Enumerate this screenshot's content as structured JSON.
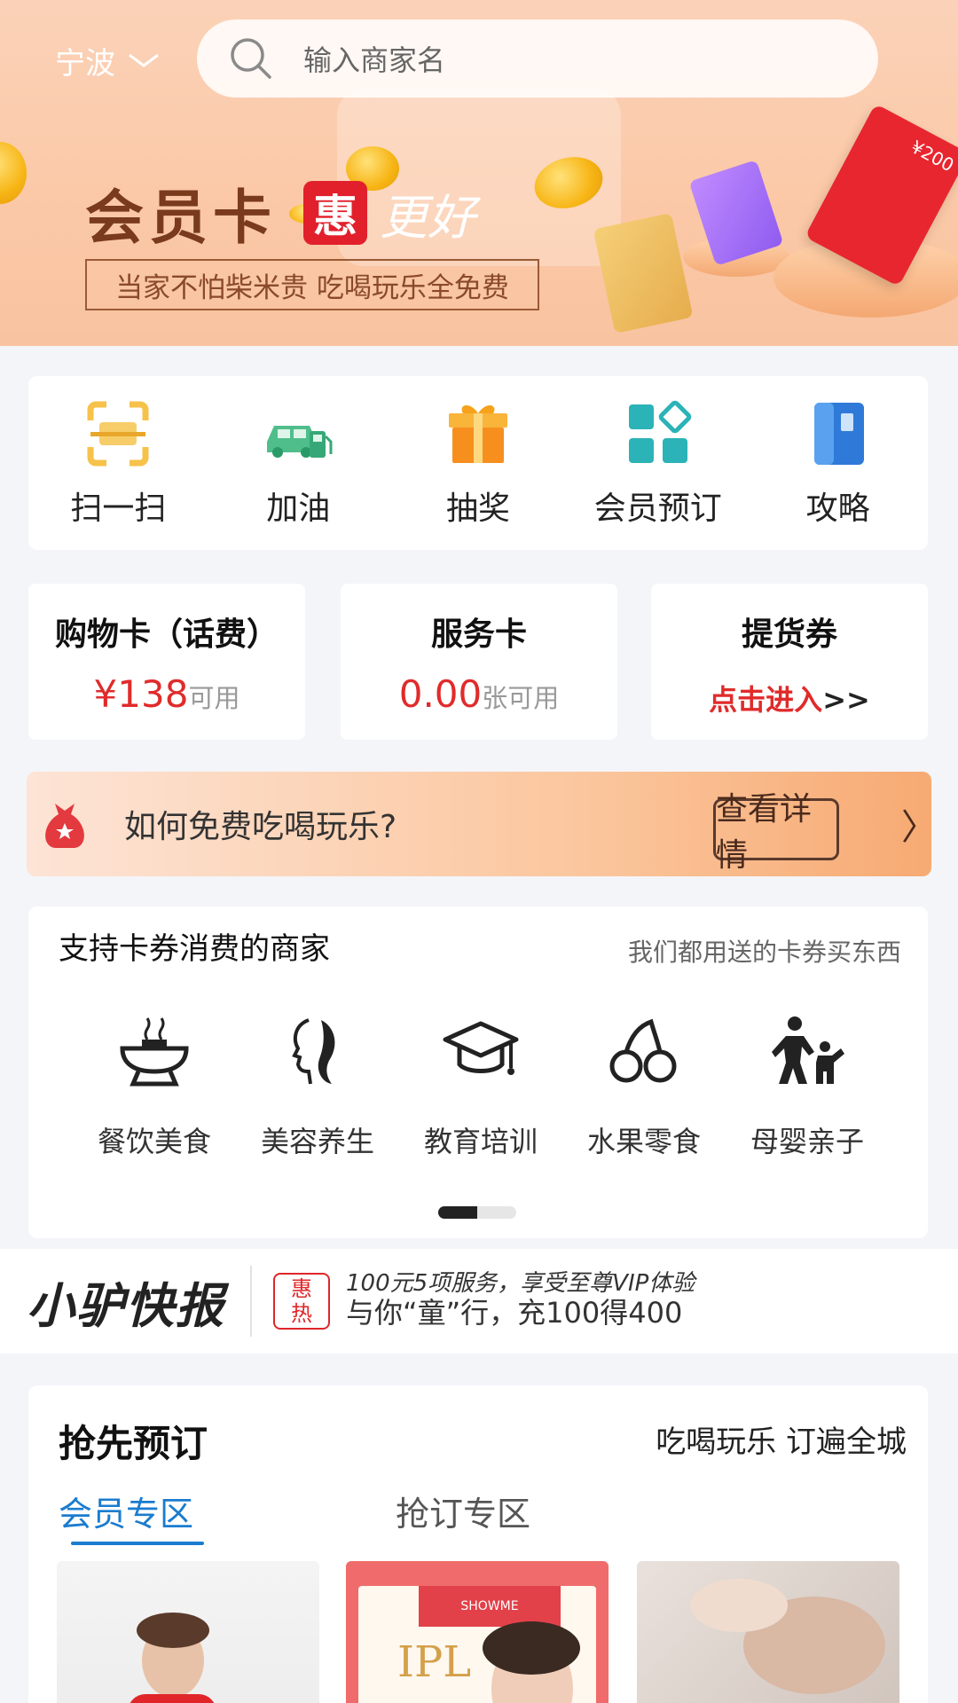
{
  "header": {
    "city": "宁波",
    "search_placeholder": "输入商家名"
  },
  "hero": {
    "title": "会员卡",
    "badge": "惠",
    "script": "更好",
    "subtitle": "当家不怕柴米贵 吃喝玩乐全免费",
    "card_red_text": "¥200"
  },
  "quick_actions": [
    {
      "label": "扫一扫",
      "icon": "scan-icon"
    },
    {
      "label": "加油",
      "icon": "fuel-icon"
    },
    {
      "label": "抽奖",
      "icon": "gift-icon"
    },
    {
      "label": "会员预订",
      "icon": "grid-icon"
    },
    {
      "label": "攻略",
      "icon": "guide-icon"
    }
  ],
  "cards": {
    "shopping": {
      "title": "购物卡（话费）",
      "value": "¥138",
      "unit": "可用"
    },
    "service": {
      "title": "服务卡",
      "value": "0.00",
      "unit": "张可用"
    },
    "voucher": {
      "title": "提货券",
      "link": "点击进入",
      "arrow": ">>"
    }
  },
  "promo": {
    "text": "如何免费吃喝玩乐?",
    "button": "查看详情",
    "chevron": "〉"
  },
  "merchants": {
    "title": "支持卡券消费的商家",
    "subtitle": "我们都用送的卡券买东西",
    "categories": [
      {
        "label": "餐饮美食",
        "icon": "food-icon"
      },
      {
        "label": "美容养生",
        "icon": "beauty-icon"
      },
      {
        "label": "教育培训",
        "icon": "education-icon"
      },
      {
        "label": "水果零食",
        "icon": "fruit-icon"
      },
      {
        "label": "母婴亲子",
        "icon": "parent-child-icon"
      }
    ]
  },
  "ticker": {
    "logo": "小驴快报",
    "tag_top": "惠",
    "tag_bottom": "热",
    "line1": "100元5项服务，享受至尊VIP体验",
    "line2": "与你“童”行，充100得400"
  },
  "booking": {
    "title": "抢先预订",
    "subtitle": "吃喝玩乐 订遍全城",
    "tabs": [
      "会员专区",
      "抢订专区"
    ],
    "thumb2_brand": "SHOWME",
    "thumb2_text": "IPL"
  },
  "colors": {
    "accent_red": "#e02b2b",
    "tab_blue": "#1a7ccf",
    "brand_brown": "#7a3a1c"
  }
}
